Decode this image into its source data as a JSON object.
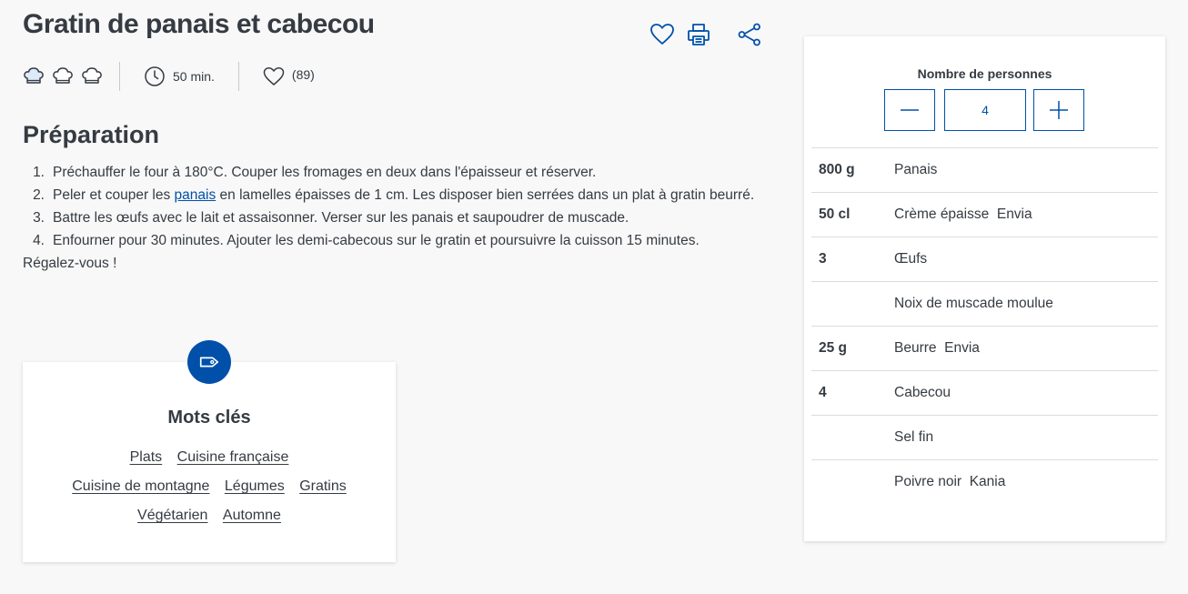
{
  "recipe": {
    "title": "Gratin de panais et cabecou",
    "duration": "50 min.",
    "likes": "(89)",
    "difficulty_hats": 3
  },
  "actions": {
    "favorite_icon": "heart-outline-icon",
    "print_icon": "printer-icon",
    "share_icon": "share-icon"
  },
  "preparation": {
    "title": "Préparation",
    "steps": [
      {
        "num": "1.",
        "text": "Préchauffer le four à 180°C. Couper les fromages en deux dans l'épaisseur et réserver."
      },
      {
        "num": "2.",
        "before": "Peler et couper les ",
        "link": "panais",
        "after": " en lamelles épaisses de 1 cm. Les disposer bien serrées dans un plat à gratin beurré."
      },
      {
        "num": "3.",
        "text": "Battre les œufs avec le lait et assaisonner. Verser sur les panais et saupoudrer de muscade."
      },
      {
        "num": "4.",
        "text": "Enfourner pour 30 minutes. Ajouter les demi-cabecous sur le gratin et poursuivre la cuisson 15 minutes."
      }
    ],
    "closing": "Régalez-vous !"
  },
  "keywords": {
    "title": "Mots clés",
    "rows": [
      [
        "Plats",
        "Cuisine française"
      ],
      [
        "Cuisine de montagne",
        "Légumes",
        "Gratins"
      ],
      [
        "Végétarien",
        "Automne"
      ]
    ]
  },
  "ingredients_panel": {
    "persons_label": "Nombre de personnes",
    "persons_value": "4",
    "items": [
      {
        "qty": "800 g",
        "name": "Panais"
      },
      {
        "qty": "50 cl",
        "name": "Crème épaisse  Envia"
      },
      {
        "qty": "3",
        "name": "Œufs"
      },
      {
        "qty": "",
        "name": "Noix de muscade moulue"
      },
      {
        "qty": "25 g",
        "name": "Beurre  Envia"
      },
      {
        "qty": "4",
        "name": "Cabecou"
      },
      {
        "qty": "",
        "name": "Sel fin"
      },
      {
        "qty": "",
        "name": "Poivre noir  Kania"
      }
    ]
  },
  "colors": {
    "accent": "#0050aa",
    "text": "#353b42",
    "background": "#f8f8f8"
  }
}
